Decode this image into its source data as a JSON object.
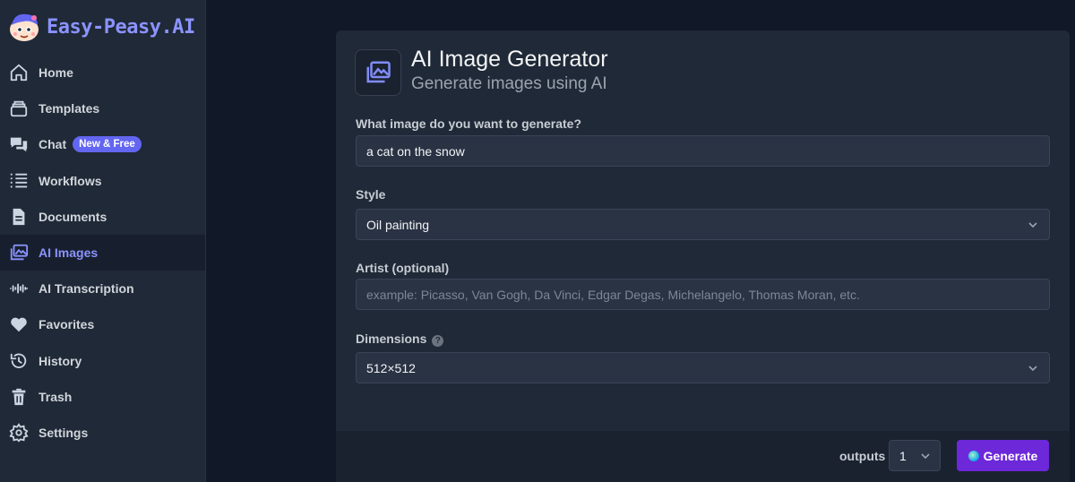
{
  "brand": {
    "name": "Easy-Peasy.AI"
  },
  "sidebar": {
    "items": [
      {
        "label": "Home",
        "icon": "home-icon"
      },
      {
        "label": "Templates",
        "icon": "templates-icon"
      },
      {
        "label": "Chat",
        "icon": "chat-icon",
        "badge": "New & Free"
      },
      {
        "label": "Workflows",
        "icon": "workflows-icon"
      },
      {
        "label": "Documents",
        "icon": "document-icon"
      },
      {
        "label": "AI Images",
        "icon": "images-icon",
        "active": true
      },
      {
        "label": "AI Transcription",
        "icon": "waveform-icon"
      },
      {
        "label": "Favorites",
        "icon": "heart-icon"
      },
      {
        "label": "History",
        "icon": "history-icon"
      },
      {
        "label": "Trash",
        "icon": "trash-icon"
      },
      {
        "label": "Settings",
        "icon": "gear-icon"
      }
    ]
  },
  "header": {
    "title": "AI Image Generator",
    "subtitle": "Generate images using AI"
  },
  "form": {
    "prompt": {
      "label": "What image do you want to generate?",
      "value": "a cat on the snow"
    },
    "style": {
      "label": "Style",
      "value": "Oil painting"
    },
    "artist": {
      "label": "Artist (optional)",
      "placeholder": "example: Picasso, Van Gogh, Da Vinci, Edgar Degas, Michelangelo, Thomas Moran, etc."
    },
    "dimensions": {
      "label": "Dimensions",
      "help": "?",
      "value": "512×512"
    }
  },
  "footer": {
    "outputs_label": "outputs",
    "outputs_value": "1",
    "generate_label": "Generate"
  },
  "colors": {
    "accent": "#8b93ff",
    "badge": "#6366f1",
    "generate_button": "#6d28d9",
    "background": "#111827",
    "panel": "#1f2937"
  }
}
